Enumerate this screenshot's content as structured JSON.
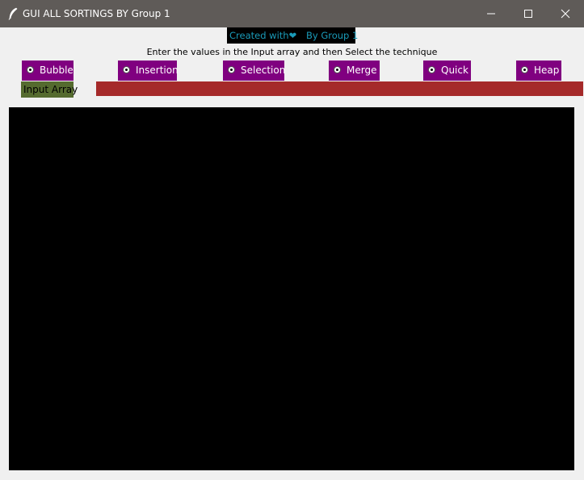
{
  "window": {
    "title": "GUI ALL SORTINGS BY Group 1",
    "icon": "feather-icon",
    "controls": [
      "minimize-icon",
      "maximize-icon",
      "close-icon"
    ]
  },
  "credit": {
    "created_with": "Created with",
    "heart": "❤",
    "by": "By Group 1"
  },
  "instruction": "Enter the values in the Input array and then Select the technique",
  "techniques": [
    {
      "label": "Bubble"
    },
    {
      "label": "Insertion"
    },
    {
      "label": "Selection"
    },
    {
      "label": "Merge"
    },
    {
      "label": "Quick"
    },
    {
      "label": "Heap"
    }
  ],
  "input": {
    "label": "Input Array",
    "value": ""
  },
  "colors": {
    "titlebar": "#5f5b58",
    "credit_bg": "#000000",
    "credit_text": "#1a9ab8",
    "radio_bg": "#800080",
    "input_label_bg": "#556b2f",
    "input_field_bg": "#a52a2a",
    "canvas_bg": "#000000"
  }
}
